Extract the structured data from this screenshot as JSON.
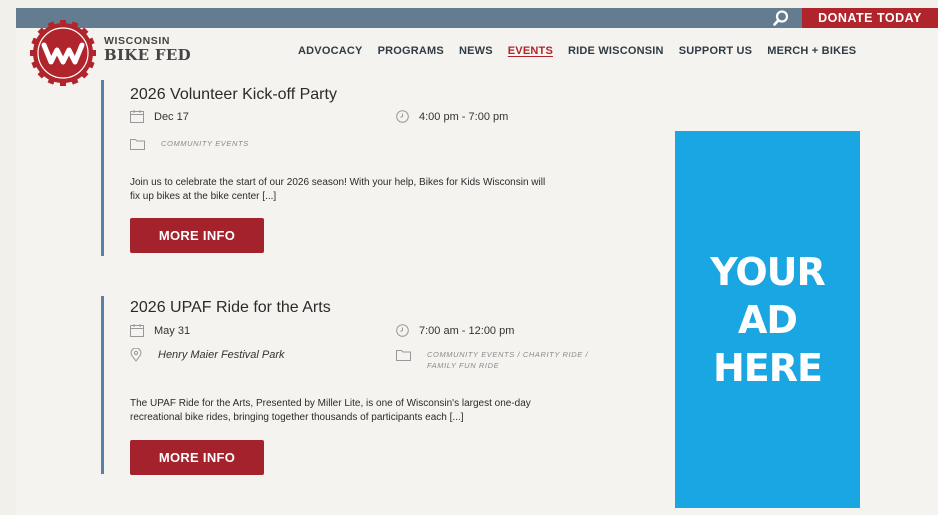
{
  "topbar": {
    "donate_label": "DONATE TODAY"
  },
  "brand": {
    "top": "WISCONSIN",
    "bottom": "BIKE FED"
  },
  "nav": [
    "ADVOCACY",
    "PROGRAMS",
    "NEWS",
    "EVENTS",
    "RIDE WISCONSIN",
    "SUPPORT US",
    "MERCH + BIKES"
  ],
  "events": [
    {
      "title": "2026 Volunteer Kick-off Party",
      "date": "Dec 17",
      "time": "4:00 pm - 7:00 pm",
      "categories_line1": "COMMUNITY EVENTS",
      "description_line1": "Join us to celebrate the start of our 2026 season! With your help, Bikes for Kids Wisconsin will",
      "description_line2": "fix up bikes at the bike center [...]",
      "button": "MORE INFO"
    },
    {
      "title": "2026 UPAF Ride for the Arts",
      "date": "May 31",
      "time": "7:00 am - 12:00 pm",
      "venue": "Henry Maier Festival Park",
      "categories_line1": "COMMUNITY EVENTS /  CHARITY RIDE /",
      "categories_line2": "FAMILY FUN RIDE",
      "description_line1": "The UPAF Ride for the Arts, Presented by Miller Lite, is one of Wisconsin's largest one-day",
      "description_line2": "recreational bike rides, bringing together thousands of participants each [...]",
      "button": "MORE INFO"
    }
  ],
  "ad": {
    "line1": "YOUR",
    "line2": "AD",
    "line3": "HERE"
  },
  "colors": {
    "brand_red": "#b0252c",
    "topbar": "#647c8f",
    "accent_blue": "#5a7fa8",
    "ad_blue": "#1aa6e3"
  }
}
